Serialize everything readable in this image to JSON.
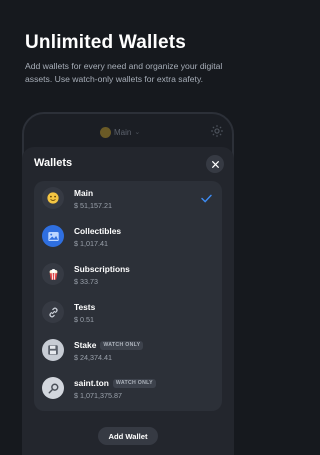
{
  "headline": "Unlimited Wallets",
  "subtitle": "Add wallets for every need and organize your digital assets. Use watch-only wallets for extra safety.",
  "phone": {
    "current_wallet_label": "Main",
    "current_wallet_icon": "smiling-face-icon"
  },
  "sheet": {
    "title": "Wallets",
    "close_icon": "close-icon",
    "add_button_label": "Add Wallet"
  },
  "wallets": [
    {
      "name": "Main",
      "balance": "$ 51,157.21",
      "icon": "smiling-face-icon",
      "tag": "",
      "selected": true
    },
    {
      "name": "Collectibles",
      "balance": "$ 1,017.41",
      "icon": "image-gallery-icon",
      "tag": "",
      "selected": false
    },
    {
      "name": "Subscriptions",
      "balance": "$ 33.73",
      "icon": "popcorn-icon",
      "tag": "",
      "selected": false
    },
    {
      "name": "Tests",
      "balance": "$ 0.51",
      "icon": "link-icon",
      "tag": "",
      "selected": false
    },
    {
      "name": "Stake",
      "balance": "$ 24,374.41",
      "icon": "floppy-disk-icon",
      "tag": "WATCH ONLY",
      "selected": false
    },
    {
      "name": "saint.ton",
      "balance": "$ 1,071,375.87",
      "icon": "magnifier-icon",
      "tag": "WATCH ONLY",
      "selected": false
    }
  ],
  "colors": {
    "background": "#16191e",
    "sheet": "#23262d",
    "list": "#2c3038",
    "accent_check": "#3d8bf2",
    "subtitle": "#a7aeb8"
  }
}
